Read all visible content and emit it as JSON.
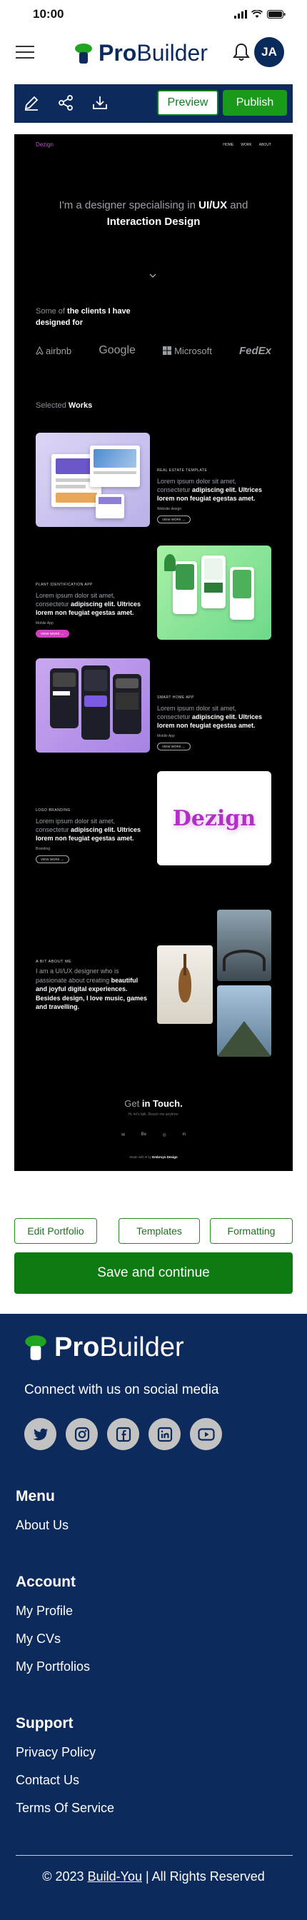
{
  "status_bar": {
    "time": "10:00"
  },
  "app": {
    "brand_bold": "Pro",
    "brand_rest": "Builder",
    "avatar_initials": "JA"
  },
  "toolbar": {
    "preview_label": "Preview",
    "publish_label": "Publish",
    "icons": [
      "edit-icon",
      "share-icon",
      "download-icon"
    ]
  },
  "portfolio": {
    "logo": "Dezign",
    "nav": [
      "HOME",
      "WORK",
      "ABOUT"
    ],
    "hero_pre": "I'm a designer specialising in ",
    "hero_bold1": "UI/UX",
    "hero_mid": " and",
    "hero_bold2": "Interaction Design",
    "clients_pre": "Some of ",
    "clients_bold": "the clients I have designed for",
    "client_logos": [
      "airbnb",
      "Google",
      "Microsoft",
      "FedEx"
    ],
    "selected_pre": "Selected ",
    "selected_bold": "Works",
    "works": [
      {
        "label": "REAL ESTATE TEMPLATE",
        "body_pre": "Lorem ipsum dolor sit amet, consectetur ",
        "body_bold": "adipiscing elit. Ultrices lorem non feugiat egestas amet.",
        "meta": "Website design",
        "button": "VIEW WORK →"
      },
      {
        "label": "PLANT IDENTIFICATION APP",
        "body_pre": "Lorem ipsum dolor sit amet, consectetur ",
        "body_bold": "adipiscing elit. Ultrices lorem non feugiat egestas amet.",
        "meta": "Mobile App",
        "button": "VIEW WORK →"
      },
      {
        "label": "SMART HOME APP",
        "body_pre": "Lorem ipsum dolor sit amet, consectetur ",
        "body_bold": "adipiscing elit. Ultrices lorem non feugiat egestas amet.",
        "meta": "Mobile App",
        "button": "VIEW WORK →"
      },
      {
        "label": "LOGO BRANDING",
        "body_pre": "Lorem ipsum dolor sit amet, consectetur ",
        "body_bold": "adipiscing elit. Ultrices lorem non feugiat egestas amet.",
        "meta": "Branding",
        "button": "VIEW WORK →",
        "logo_text": "Dezign"
      }
    ],
    "about_label": "A BIT ABOUT ME",
    "about_pre": "I am a UI/UX designer who is passionate about creating ",
    "about_bold": "beautiful and joyful digital experiences. Besides design, I love music, games and travelling.",
    "touch_pre": "Get ",
    "touch_bold": "in Touch.",
    "touch_sub": "Hi, let's talk. Reach me anytime.",
    "social": [
      "✉",
      "Be",
      "◎",
      "in"
    ],
    "made_pre": "Made with ♥ by ",
    "made_bold": "Embroys Design"
  },
  "actions": {
    "edit_portfolio": "Edit Portfolio",
    "templates": "Templates",
    "formatting": "Formatting",
    "save": "Save and continue"
  },
  "footer": {
    "brand_bold": "Pro",
    "brand_rest": "Builder",
    "connect": "Connect with us on social media",
    "social_icons": [
      "twitter-icon",
      "instagram-icon",
      "facebook-icon",
      "linkedin-icon",
      "youtube-icon"
    ],
    "menu_heading": "Menu",
    "menu_links": [
      "About Us"
    ],
    "account_heading": "Account",
    "account_links": [
      "My Profile",
      "My CVs",
      "My Portfolios"
    ],
    "support_heading": "Support",
    "support_links": [
      "Privacy Policy",
      "Contact Us",
      "Terms Of Service"
    ],
    "copyright_pre": "© 2023 ",
    "copyright_link": "Build-You",
    "copyright_post": " | All Rights Reserved"
  }
}
